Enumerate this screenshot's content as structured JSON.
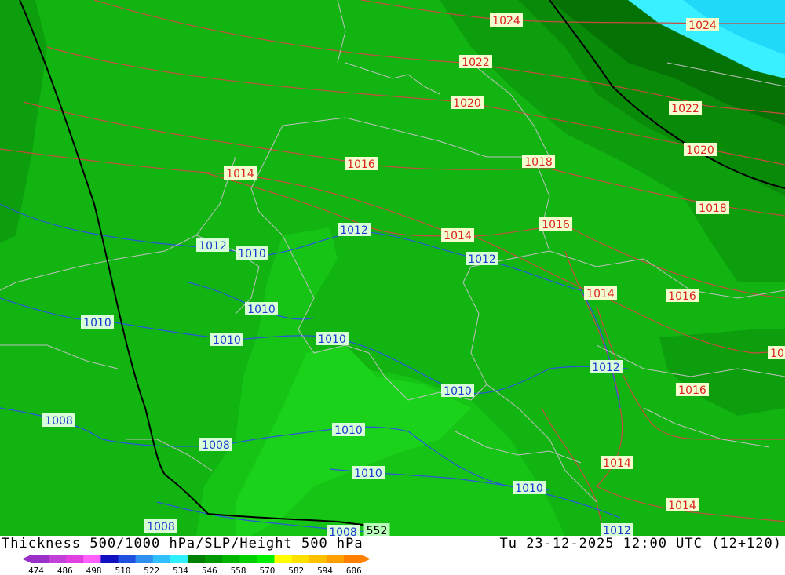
{
  "title_left": "Thickness 500/1000 hPa/SLP/Height 500 hPa",
  "title_right": "Tu 23-12-2025 12:00 UTC (12+120)",
  "colors": {
    "water": "#38f0ff",
    "land_bg": "#11b411",
    "slp_contour": "#c84a40",
    "low_contour": "#2b55e0",
    "border": "#c0c0c0",
    "height_contour": "#000000"
  },
  "colorbar": {
    "ticks": [
      "474",
      "486",
      "498",
      "510",
      "522",
      "534",
      "546",
      "558",
      "570",
      "582",
      "594",
      "606"
    ],
    "colors": [
      "#9b30c8",
      "#c040d8",
      "#e040e0",
      "#ff60ff",
      "#1010c0",
      "#2050e0",
      "#3090f0",
      "#30c0ff",
      "#30f0ff",
      "#008000",
      "#009a00",
      "#00b400",
      "#00d000",
      "#00f000",
      "#ffff00",
      "#ffe000",
      "#ffc000",
      "#ffa000",
      "#ff8000"
    ]
  },
  "labels": [
    {
      "text": "1024",
      "cls": "red"
    },
    {
      "text": "1024",
      "cls": "red"
    },
    {
      "text": "1022",
      "cls": "red"
    },
    {
      "text": "1022",
      "cls": "red"
    },
    {
      "text": "1020",
      "cls": "red"
    },
    {
      "text": "1020",
      "cls": "red"
    },
    {
      "text": "1018",
      "cls": "red"
    },
    {
      "text": "1018",
      "cls": "red"
    },
    {
      "text": "1016",
      "cls": "red"
    },
    {
      "text": "1016",
      "cls": "red"
    },
    {
      "text": "1016",
      "cls": "red"
    },
    {
      "text": "1016",
      "cls": "red"
    },
    {
      "text": "1014",
      "cls": "red"
    },
    {
      "text": "1014",
      "cls": "red"
    },
    {
      "text": "1014",
      "cls": "red"
    },
    {
      "text": "1014",
      "cls": "red"
    },
    {
      "text": "1014",
      "cls": "red"
    },
    {
      "text": "10",
      "cls": "red"
    },
    {
      "text": "1012",
      "cls": "blue"
    },
    {
      "text": "1012",
      "cls": "blue"
    },
    {
      "text": "1012",
      "cls": "blue"
    },
    {
      "text": "1012",
      "cls": "blue"
    },
    {
      "text": "1012",
      "cls": "blue"
    },
    {
      "text": "1010",
      "cls": "blue"
    },
    {
      "text": "1010",
      "cls": "blue"
    },
    {
      "text": "1010",
      "cls": "blue"
    },
    {
      "text": "1010",
      "cls": "blue"
    },
    {
      "text": "1010",
      "cls": "blue"
    },
    {
      "text": "1010",
      "cls": "blue"
    },
    {
      "text": "1010",
      "cls": "blue"
    },
    {
      "text": "1010",
      "cls": "blue"
    },
    {
      "text": "1010",
      "cls": "blue"
    },
    {
      "text": "1008",
      "cls": "blue"
    },
    {
      "text": "1008",
      "cls": "blue"
    },
    {
      "text": "1008",
      "cls": "blue"
    },
    {
      "text": "1008",
      "cls": "blue"
    },
    {
      "text": "552",
      "cls": "black"
    }
  ]
}
